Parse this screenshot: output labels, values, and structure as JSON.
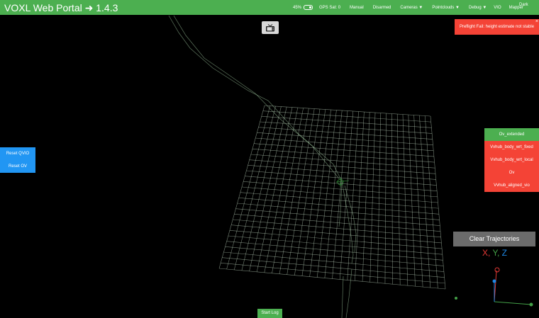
{
  "header": {
    "title": "VOXL Web Portal ➜ 1.4.3",
    "battery": "45%",
    "gps": "GPS Sat: 0",
    "mode": "Manual",
    "arm_state": "Disarmed",
    "menus": [
      "Cameras ▼",
      "Pointclouds ▼",
      "Debug ▼",
      "VIO",
      "Mapper"
    ],
    "theme": "Dark"
  },
  "alert": {
    "message": "Preflight Fail: height estimate not stable",
    "close": "×"
  },
  "left_buttons": [
    "Reset QVIO",
    "Reset OV"
  ],
  "frames": [
    {
      "label": "Ov_extended",
      "color": "#4caf50"
    },
    {
      "label": "Vvhub_body_wrt_fixed",
      "color": "#f44336"
    },
    {
      "label": "Vvhub_body_wrt_local",
      "color": "#f44336"
    },
    {
      "label": "Ov",
      "color": "#f44336"
    },
    {
      "label": "Vvhub_aligned_vio",
      "color": "#f44336"
    }
  ],
  "clear_trajectories": "Clear Trajectories",
  "axes": {
    "x": "X",
    "comma1": ",",
    "y": "Y",
    "comma2": ",",
    "z": "Z"
  },
  "start_log": "Start Log",
  "colors": {
    "accent": "#4caf50",
    "danger": "#f44336",
    "info": "#2196f3",
    "grid": "#d8ffd8"
  }
}
